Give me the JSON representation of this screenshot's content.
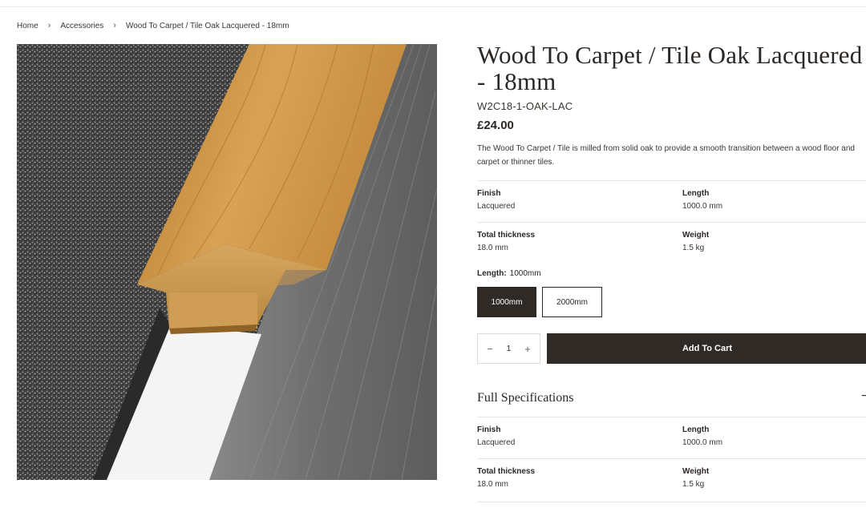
{
  "breadcrumb": {
    "items": [
      "Home",
      "Accessories",
      "Wood To Carpet / Tile Oak Lacquered - 18mm"
    ]
  },
  "product": {
    "title": "Wood To Carpet / Tile Oak Lacquered - 18mm",
    "sku": "W2C18-1-OAK-LAC",
    "price": "£24.00",
    "description": "The Wood To Carpet / Tile is milled from solid oak to provide a smooth transition between a wood floor and carpet or thinner tiles."
  },
  "specs": {
    "finish_label": "Finish",
    "finish_value": "Lacquered",
    "length_label": "Length",
    "length_value": "1000.0 mm",
    "thickness_label": "Total thickness",
    "thickness_value": "18.0 mm",
    "weight_label": "Weight",
    "weight_value": "1.5 kg"
  },
  "variant": {
    "label": "Length:",
    "selected": "1000mm",
    "options": [
      "1000mm",
      "2000mm"
    ]
  },
  "purchase": {
    "quantity": "1",
    "minus": "−",
    "plus": "+",
    "add_to_cart": "Add To Cart"
  },
  "full_specs": {
    "heading": "Full Specifications",
    "toggle": "−"
  },
  "icons": {
    "breadcrumb_separator": "chevron-right-icon"
  },
  "colors": {
    "primary_dark": "#2f2a25",
    "text": "#2b2724",
    "border": "#e6e6e6"
  }
}
